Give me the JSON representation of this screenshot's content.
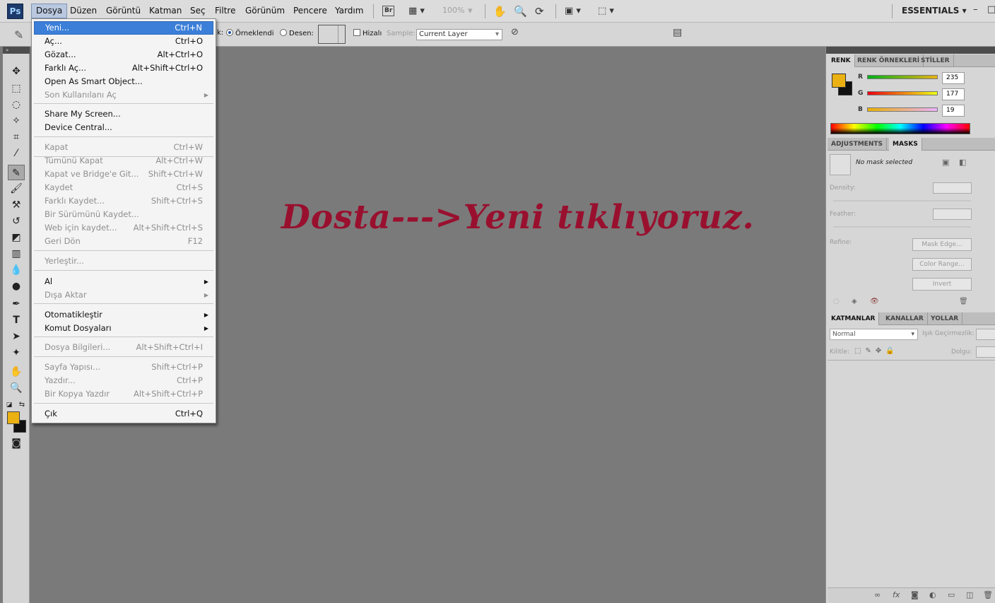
{
  "menubar": {
    "app_logo": "Ps",
    "items": [
      "Dosya",
      "Düzen",
      "Görüntü",
      "Katman",
      "Seç",
      "Filtre",
      "Görünüm",
      "Pencere",
      "Yardım"
    ],
    "bridge_label": "Br",
    "zoom": "100%",
    "workspace": "ESSENTIALS",
    "window_controls": [
      "–",
      "□"
    ]
  },
  "options_bar": {
    "source_suffix": "k:",
    "sampled_label": "Örneklendi",
    "pattern_label": "Desen:",
    "aligned_label": "Hizalı",
    "sample_label": "Sample:",
    "sample_value": "Current Layer"
  },
  "file_menu": {
    "items": [
      {
        "label": "Yeni...",
        "shortcut": "Ctrl+N",
        "disabled": false
      },
      {
        "label": "Aç...",
        "shortcut": "Ctrl+O",
        "disabled": false
      },
      {
        "label": "Gözat...",
        "shortcut": "Alt+Ctrl+O",
        "disabled": false
      },
      {
        "label": "Farklı Aç...",
        "shortcut": "Alt+Shift+Ctrl+O",
        "disabled": false
      },
      {
        "label": "Open As Smart Object...",
        "shortcut": "",
        "disabled": false
      },
      {
        "label": "Son Kullanılanı Aç",
        "shortcut": "",
        "disabled": true
      },
      {
        "label": "Share My Screen...",
        "shortcut": "",
        "disabled": false
      },
      {
        "label": "Device Central...",
        "shortcut": "",
        "disabled": false
      },
      {
        "label": "Kapat",
        "shortcut": "Ctrl+W",
        "disabled": true
      },
      {
        "label": "Tümünü Kapat",
        "shortcut": "Alt+Ctrl+W",
        "disabled": true
      },
      {
        "label": "Kapat ve Bridge'e Git...",
        "shortcut": "Shift+Ctrl+W",
        "disabled": true
      },
      {
        "label": "Kaydet",
        "shortcut": "Ctrl+S",
        "disabled": true
      },
      {
        "label": "Farklı Kaydet...",
        "shortcut": "Shift+Ctrl+S",
        "disabled": true
      },
      {
        "label": "Bir Sürümünü Kaydet...",
        "shortcut": "",
        "disabled": true
      },
      {
        "label": "Web için kaydet...",
        "shortcut": "Alt+Shift+Ctrl+S",
        "disabled": true
      },
      {
        "label": "Geri Dön",
        "shortcut": "F12",
        "disabled": true
      },
      {
        "label": "Yerleştir...",
        "shortcut": "",
        "disabled": true
      },
      {
        "label": "Al",
        "shortcut": "",
        "disabled": false
      },
      {
        "label": "Dışa Aktar",
        "shortcut": "",
        "disabled": true
      },
      {
        "label": "Otomatikleştir",
        "shortcut": "",
        "disabled": false
      },
      {
        "label": "Komut Dosyaları",
        "shortcut": "",
        "disabled": false
      },
      {
        "label": "Dosya Bilgileri...",
        "shortcut": "Alt+Shift+Ctrl+I",
        "disabled": true
      },
      {
        "label": "Sayfa Yapısı...",
        "shortcut": "Shift+Ctrl+P",
        "disabled": true
      },
      {
        "label": "Yazdır...",
        "shortcut": "Ctrl+P",
        "disabled": true
      },
      {
        "label": "Bir Kopya Yazdır",
        "shortcut": "Alt+Shift+Ctrl+P",
        "disabled": true
      },
      {
        "label": "Çık",
        "shortcut": "Ctrl+Q",
        "disabled": false
      }
    ]
  },
  "canvas": {
    "instruction": "Dosta--->Yeni tıklıyoruz."
  },
  "color_panel": {
    "tabs": [
      "RENK",
      "RENK ÖRNEKLERİ",
      "STİLLER"
    ],
    "channels": [
      {
        "label": "R",
        "value": "235"
      },
      {
        "label": "G",
        "value": "177"
      },
      {
        "label": "B",
        "value": "19"
      }
    ],
    "foreground_color": "#ebb113",
    "background_color": "#111111"
  },
  "masks_panel": {
    "tabs": [
      "ADJUSTMENTS",
      "MASKS"
    ],
    "status": "No mask selected",
    "density_label": "Density:",
    "feather_label": "Feather:",
    "refine_label": "Refine:",
    "buttons": [
      "Mask Edge...",
      "Color Range...",
      "Invert"
    ]
  },
  "layers_panel": {
    "tabs": [
      "KATMANLAR",
      "KANALLAR",
      "YOLLAR"
    ],
    "blend_mode": "Normal",
    "opacity_label": "Işık Geçirmezlik:",
    "lock_label": "Kilitle:",
    "fill_label": "Dolgu:"
  },
  "colors": {
    "instruction_text": "#99102f",
    "highlight": "#3c7fd8"
  }
}
